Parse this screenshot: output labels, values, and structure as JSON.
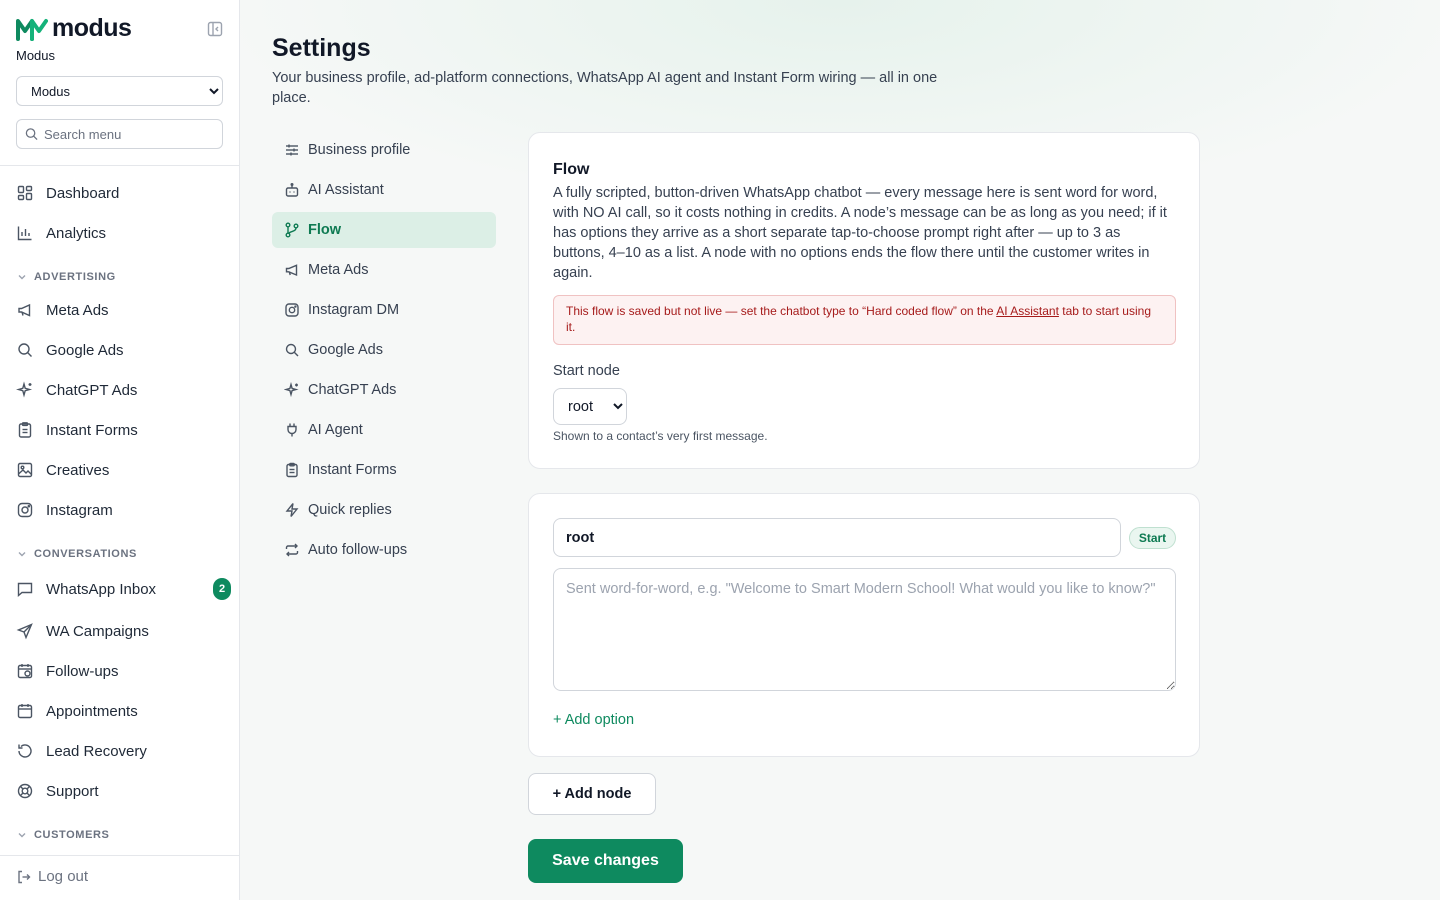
{
  "brand": {
    "name": "modus",
    "accent": "#0e8a5f"
  },
  "org": {
    "name": "Modus",
    "selected": "Modus",
    "options": [
      "Modus"
    ]
  },
  "search": {
    "placeholder": "Search menu"
  },
  "sidebar": {
    "items": [
      {
        "label": "Dashboard",
        "icon": "dashboard-icon"
      },
      {
        "label": "Analytics",
        "icon": "analytics-icon"
      },
      {
        "section": "ADVERTISING"
      },
      {
        "label": "Meta Ads",
        "icon": "megaphone-icon"
      },
      {
        "label": "Google Ads",
        "icon": "search-icon"
      },
      {
        "label": "ChatGPT Ads",
        "icon": "sparkles-icon"
      },
      {
        "label": "Instant Forms",
        "icon": "clipboard-icon"
      },
      {
        "label": "Creatives",
        "icon": "image-icon"
      },
      {
        "label": "Instagram",
        "icon": "instagram-icon"
      },
      {
        "section": "CONVERSATIONS"
      },
      {
        "label": "WhatsApp Inbox",
        "icon": "chat-icon",
        "badge": "2"
      },
      {
        "label": "WA Campaigns",
        "icon": "send-icon"
      },
      {
        "label": "Follow-ups",
        "icon": "calendar-clock-icon"
      },
      {
        "label": "Appointments",
        "icon": "calendar-icon"
      },
      {
        "label": "Lead Recovery",
        "icon": "refresh-icon"
      },
      {
        "label": "Support",
        "icon": "lifebuoy-icon"
      },
      {
        "section": "CUSTOMERS"
      }
    ],
    "logout": "Log out"
  },
  "page": {
    "title": "Settings",
    "subtitle": "Your business profile, ad-platform connections, WhatsApp AI agent and Instant Form wiring — all in one place."
  },
  "subnav": [
    {
      "label": "Business profile",
      "icon": "sliders-icon",
      "active": false
    },
    {
      "label": "AI Assistant",
      "icon": "bot-icon",
      "active": false
    },
    {
      "label": "Flow",
      "icon": "flow-icon",
      "active": true
    },
    {
      "label": "Meta Ads",
      "icon": "megaphone-icon",
      "active": false
    },
    {
      "label": "Instagram DM",
      "icon": "instagram-icon",
      "active": false
    },
    {
      "label": "Google Ads",
      "icon": "search-icon",
      "active": false
    },
    {
      "label": "ChatGPT Ads",
      "icon": "sparkles-icon",
      "active": false
    },
    {
      "label": "AI Agent",
      "icon": "plug-icon",
      "active": false
    },
    {
      "label": "Instant Forms",
      "icon": "clipboard-icon",
      "active": false
    },
    {
      "label": "Quick replies",
      "icon": "bolt-icon",
      "active": false
    },
    {
      "label": "Auto follow-ups",
      "icon": "repeat-icon",
      "active": false
    }
  ],
  "flow": {
    "title": "Flow",
    "description": "A fully scripted, button-driven WhatsApp chatbot — every message here is sent word for word, with NO AI call, so it costs nothing in credits. A node’s message can be as long as you need; if it has options they arrive as a short separate tap-to-choose prompt right after — up to 3 as buttons, 4–10 as a list. A node with no options ends the flow there until the customer writes in again.",
    "warning_before": "This flow is saved but not live — set the chatbot type to “Hard coded flow” on the ",
    "warning_link": "AI Assistant",
    "warning_after": " tab to start using it.",
    "start_node_label": "Start node",
    "start_node_value": "root",
    "start_node_options": [
      "root"
    ],
    "start_node_help": "Shown to a contact’s very first message."
  },
  "node": {
    "name": "root",
    "badge": "Start",
    "message_value": "",
    "message_placeholder": "Sent word-for-word, e.g. \"Welcome to Smart Modern School! What would you like to know?\"",
    "add_option": "+ Add option"
  },
  "actions": {
    "add_node": "+ Add node",
    "save": "Save changes"
  }
}
